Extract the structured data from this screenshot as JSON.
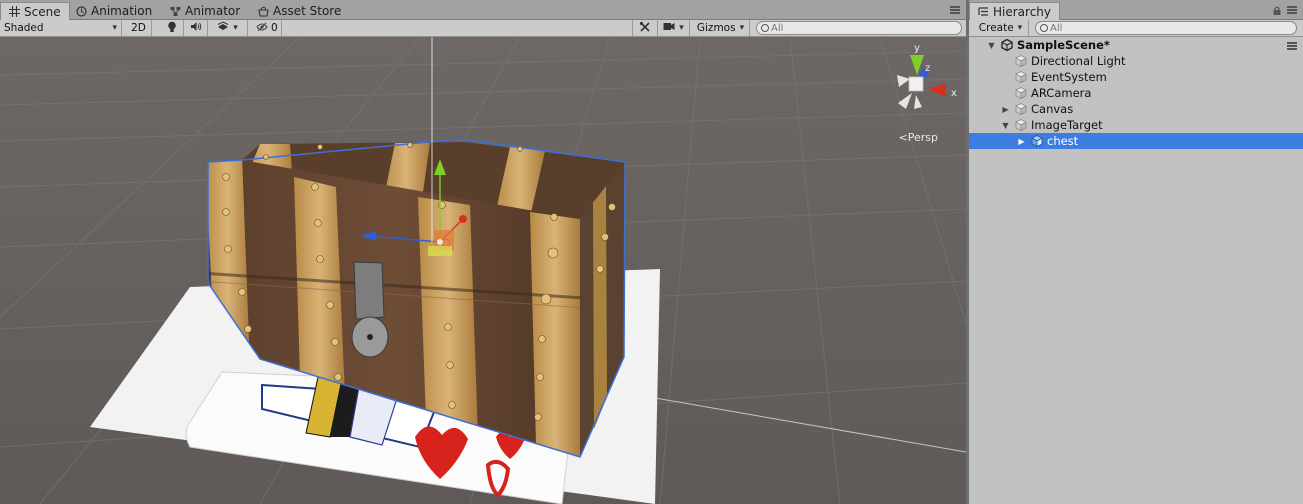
{
  "scene_tabs": [
    {
      "label": "Scene",
      "icon": "grid-icon",
      "active": true
    },
    {
      "label": "Animation",
      "icon": "clock-icon",
      "active": false
    },
    {
      "label": "Animator",
      "icon": "animator-icon",
      "active": false
    },
    {
      "label": "Asset Store",
      "icon": "store-icon",
      "active": false
    }
  ],
  "scene_toolbar": {
    "shading_mode": "Shaded",
    "mode_2d": "2D",
    "hidden_count": "0",
    "gizmos_label": "Gizmos",
    "search_placeholder": "All"
  },
  "viewport": {
    "projection_label": "Persp",
    "axis_labels": {
      "x": "x",
      "y": "y",
      "z": "z"
    }
  },
  "hierarchy": {
    "tab_label": "Hierarchy",
    "create_label": "Create",
    "search_placeholder": "All",
    "scene_name": "SampleScene*",
    "items": [
      {
        "label": "Directional Light",
        "depth": 1,
        "foldout": "none",
        "selected": false
      },
      {
        "label": "EventSystem",
        "depth": 1,
        "foldout": "none",
        "selected": false
      },
      {
        "label": "ARCamera",
        "depth": 1,
        "foldout": "none",
        "selected": false
      },
      {
        "label": "Canvas",
        "depth": 1,
        "foldout": "collapsed",
        "selected": false
      },
      {
        "label": "ImageTarget",
        "depth": 1,
        "foldout": "expanded",
        "selected": false
      },
      {
        "label": "chest",
        "depth": 2,
        "foldout": "collapsed",
        "selected": true
      }
    ]
  },
  "colors": {
    "selection": "#3e7de0",
    "axis_x": "#d8301e",
    "axis_y": "#7fcf2a",
    "axis_z": "#2e5fd8",
    "panel_bg": "#c2c2c2"
  }
}
